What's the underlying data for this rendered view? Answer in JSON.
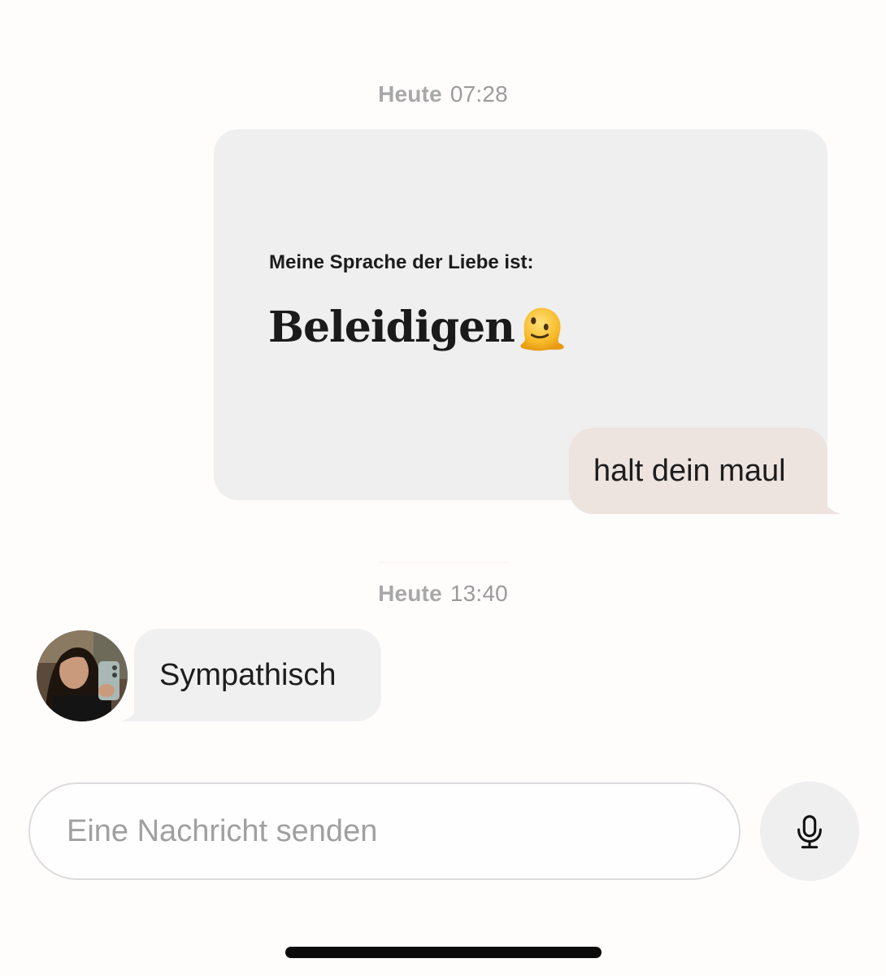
{
  "timestamps": [
    {
      "day": "Heute",
      "time": "07:28"
    },
    {
      "day": "Heute",
      "time": "13:40"
    }
  ],
  "prompt_card": {
    "question": "Meine Sprache der Liebe ist:",
    "answer": "Beleidigen",
    "emoji_icon": "melting-face-emoji"
  },
  "messages": {
    "outgoing_reply": "halt dein maul",
    "incoming_reply": "Sympathisch"
  },
  "composer": {
    "placeholder": "Eine Nachricht senden",
    "mic_icon": "microphone-icon"
  },
  "colors": {
    "outgoing_bubble": "#ede4e0",
    "incoming_bubble": "#f0f0f0",
    "card_background": "#efefef"
  }
}
